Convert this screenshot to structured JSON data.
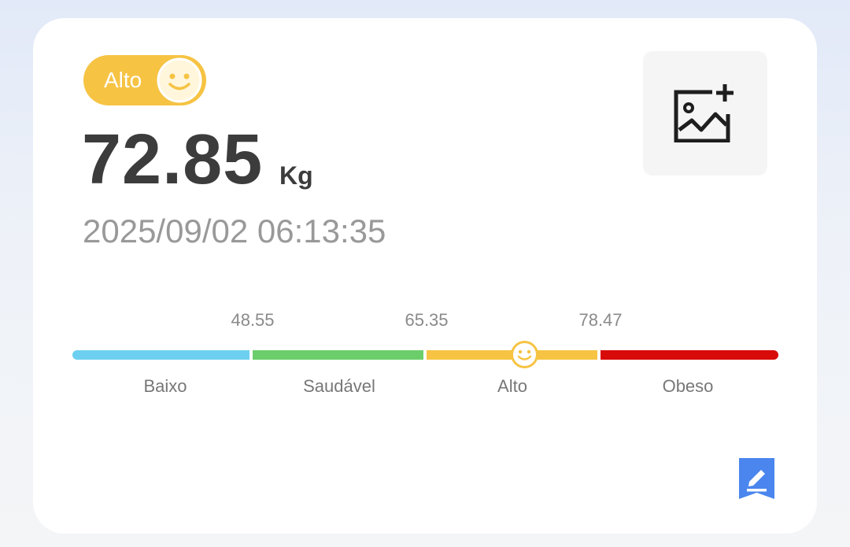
{
  "status_badge": {
    "label": "Alto",
    "icon": "smiley-face-icon",
    "color": "#f6c343"
  },
  "measurement": {
    "value": "72.85",
    "unit": "Kg",
    "timestamp": "2025/09/02 06:13:35"
  },
  "photo_button": {
    "icon": "add-image-icon"
  },
  "scale": {
    "thresholds": [
      "48.55",
      "65.35",
      "78.47"
    ],
    "categories": [
      {
        "label": "Baixo",
        "color": "#6dd0f0"
      },
      {
        "label": "Saudável",
        "color": "#6cce6a"
      },
      {
        "label": "Alto",
        "color": "#f6c343"
      },
      {
        "label": "Obeso",
        "color": "#d80a0a"
      }
    ],
    "marker_icon": "smiley-face-icon"
  },
  "edit_button": {
    "icon": "edit-pencil-icon",
    "color": "#4a86ee"
  }
}
